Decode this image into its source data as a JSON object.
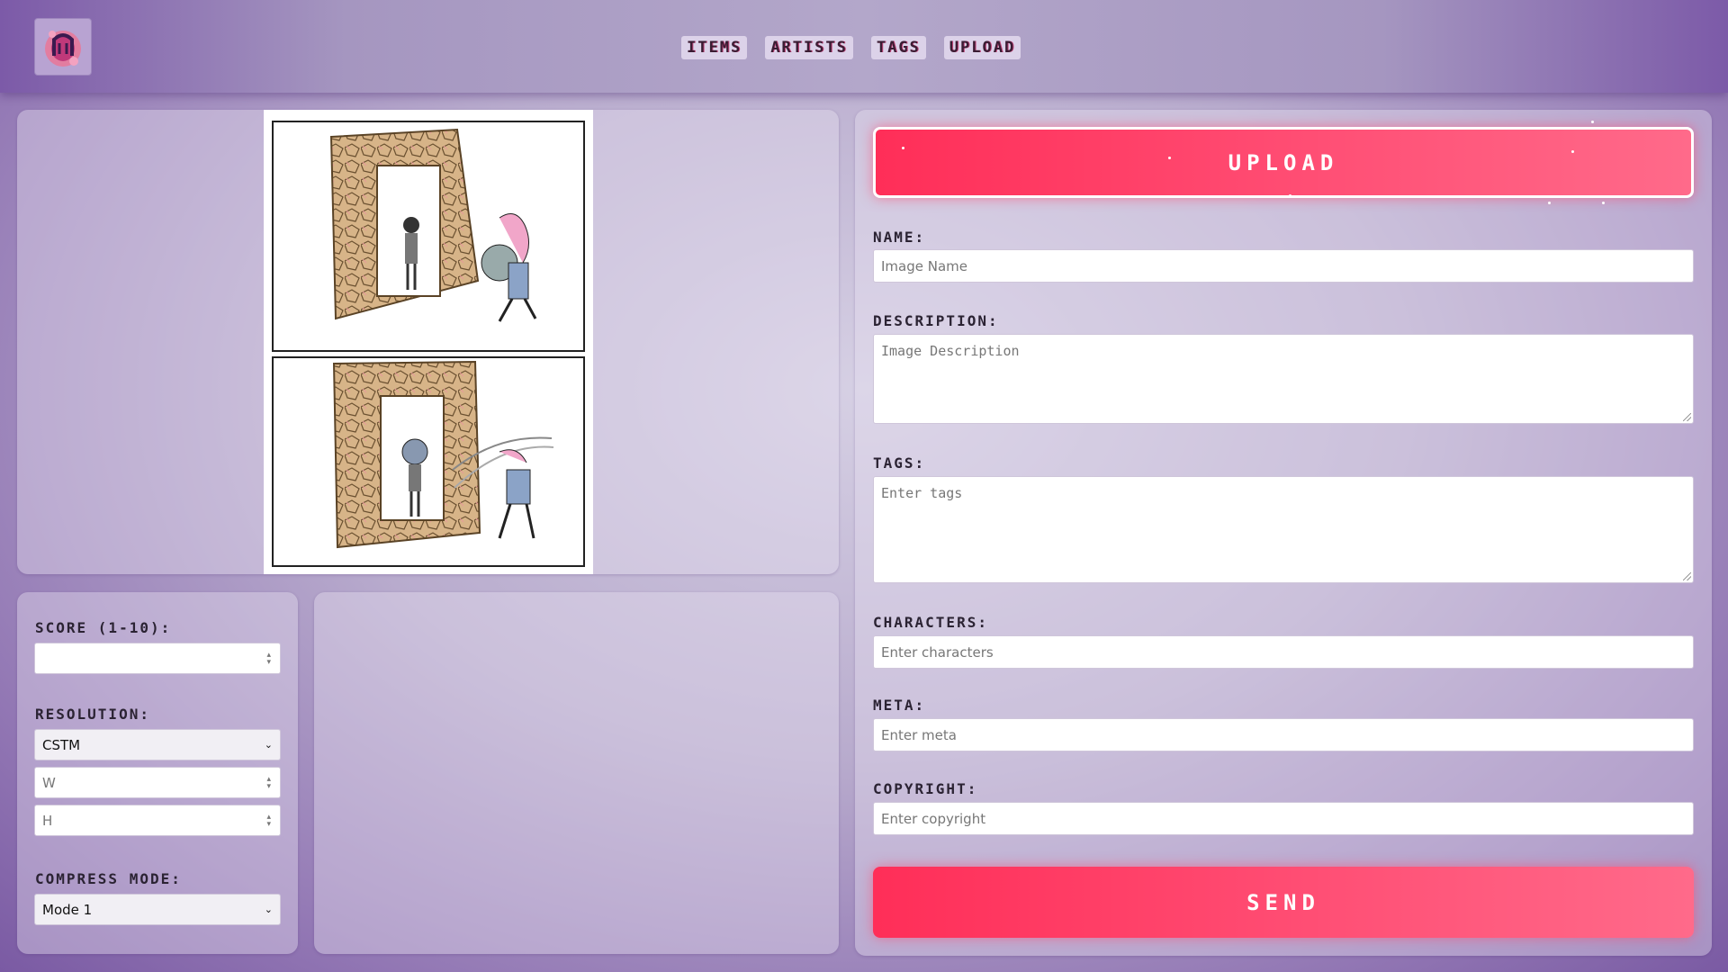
{
  "nav": {
    "items": [
      "ITEMS",
      "ARTISTS",
      "TAGS",
      "UPLOAD"
    ]
  },
  "options": {
    "score_label": "SCORE (1-10):",
    "score_value": "",
    "resolution_label": "RESOLUTION:",
    "resolution_selected": "CSTM",
    "width_placeholder": "W",
    "height_placeholder": "H",
    "compress_label": "COMPRESS MODE:",
    "compress_selected": "Mode 1"
  },
  "form": {
    "upload_button": "UPLOAD",
    "name_label": "NAME:",
    "name_placeholder": "Image Name",
    "description_label": "DESCRIPTION:",
    "description_placeholder": "Image Description",
    "tags_label": "TAGS:",
    "tags_placeholder": "Enter tags",
    "characters_label": "CHARACTERS:",
    "characters_placeholder": "Enter characters",
    "meta_label": "META:",
    "meta_placeholder": "Enter meta",
    "copyright_label": "COPYRIGHT:",
    "copyright_placeholder": "Enter copyright",
    "send_button": "SEND"
  },
  "colors": {
    "accent": "#ff3d63",
    "background": "#b8abcd"
  }
}
